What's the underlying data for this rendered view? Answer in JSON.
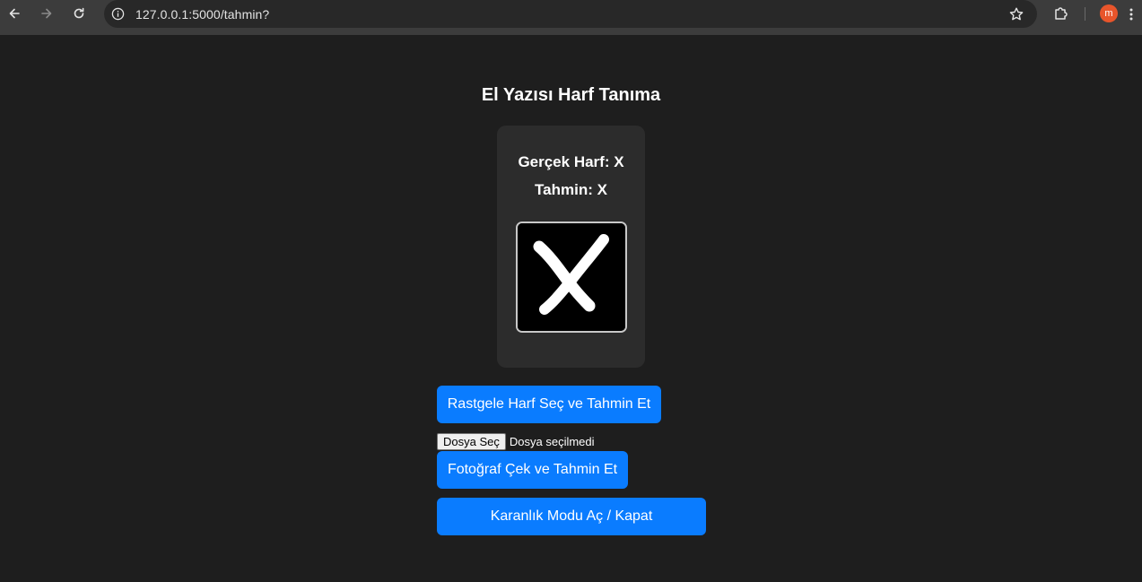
{
  "browser": {
    "url": "127.0.0.1:5000/tahmin?",
    "profile_initial": "m"
  },
  "page": {
    "title": "El Yazısı Harf Tanıma",
    "result": {
      "real_label": "Gerçek Harf: X",
      "prediction_label": "Tahmin: X"
    },
    "buttons": {
      "random": "Rastgele Harf Seç ve Tahmin Et",
      "choose_file": "Dosya Seç",
      "file_status": "Dosya seçilmedi",
      "photo": "Fotoğraf Çek ve Tahmin Et",
      "dark_mode": "Karanlık Modu Aç / Kapat"
    }
  },
  "colors": {
    "background": "#1e1e1e",
    "card": "#2c2c2c",
    "accent": "#0a7cff",
    "avatar": "#e8552b"
  }
}
